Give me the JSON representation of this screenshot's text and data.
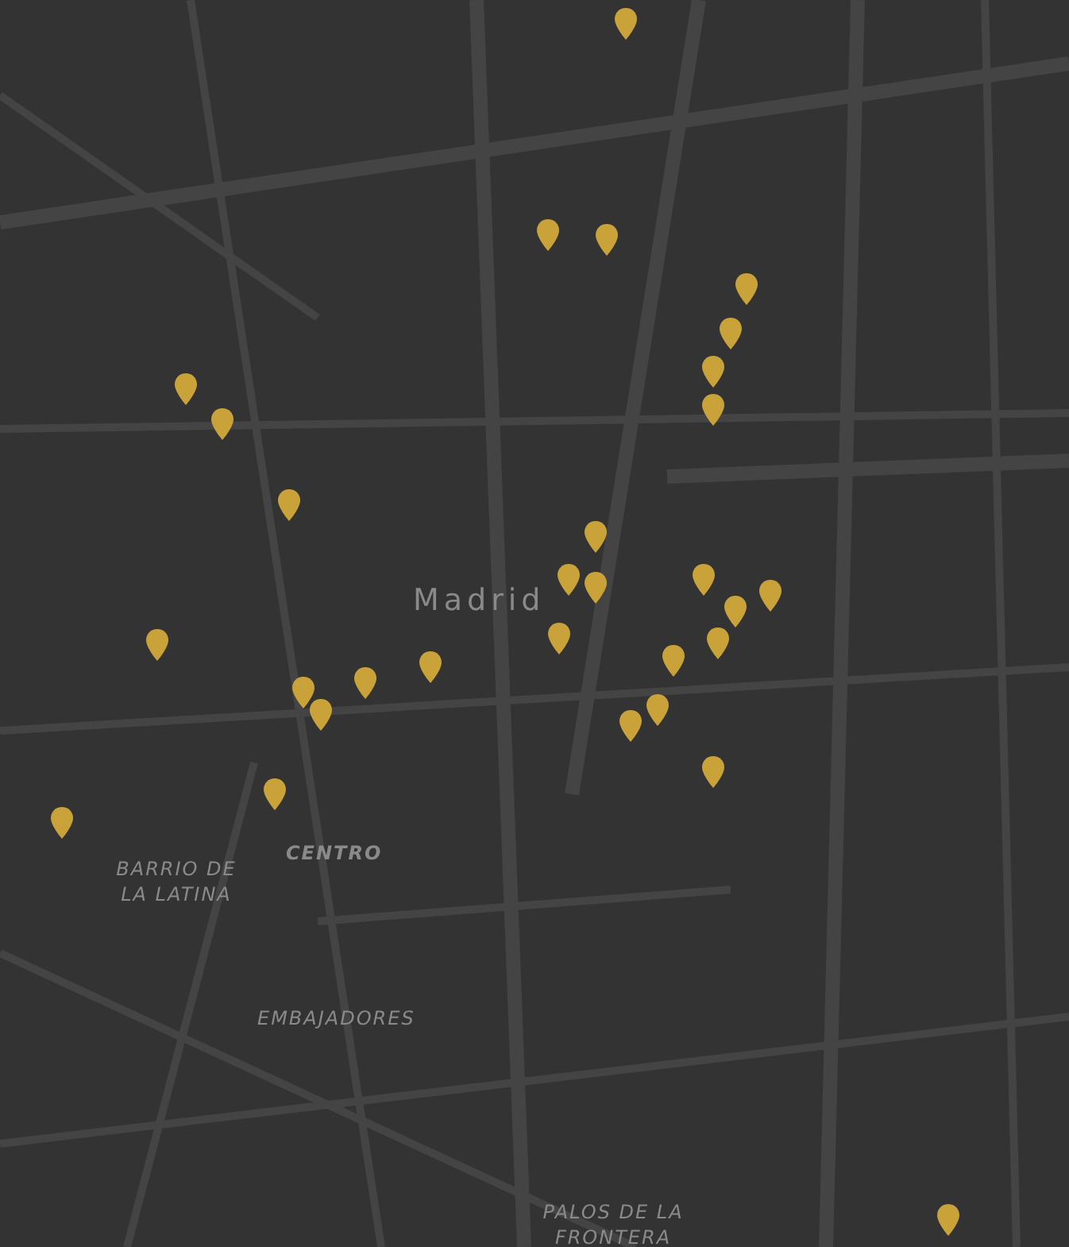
{
  "map": {
    "place_labels": [
      {
        "text": "Madrid",
        "kind": "city"
      },
      {
        "text": "CENTRO",
        "kind": "district"
      },
      {
        "text": "BARRIO DE LA LATINA",
        "kind": "neighborhood"
      },
      {
        "text": "EMBAJADORES",
        "kind": "neighborhood"
      },
      {
        "text": "PALOS DE LA FRONTERA",
        "kind": "neighborhood"
      }
    ],
    "markers": [
      {
        "kind": "pin"
      },
      {
        "kind": "pin"
      },
      {
        "kind": "pin"
      },
      {
        "kind": "pin"
      },
      {
        "kind": "pin"
      },
      {
        "kind": "pin"
      },
      {
        "kind": "pin"
      },
      {
        "kind": "pin"
      },
      {
        "kind": "pin"
      },
      {
        "kind": "pin"
      },
      {
        "kind": "pin"
      },
      {
        "kind": "pin"
      },
      {
        "kind": "pin"
      },
      {
        "kind": "pin"
      },
      {
        "kind": "pin"
      },
      {
        "kind": "pin"
      },
      {
        "kind": "pin"
      },
      {
        "kind": "pin"
      },
      {
        "kind": "pin"
      },
      {
        "kind": "pin"
      },
      {
        "kind": "pin"
      },
      {
        "kind": "pin"
      },
      {
        "kind": "pin"
      },
      {
        "kind": "pin"
      },
      {
        "kind": "pin"
      },
      {
        "kind": "pin"
      },
      {
        "kind": "pin"
      },
      {
        "kind": "pin"
      },
      {
        "kind": "pin"
      },
      {
        "kind": "pin"
      }
    ]
  }
}
